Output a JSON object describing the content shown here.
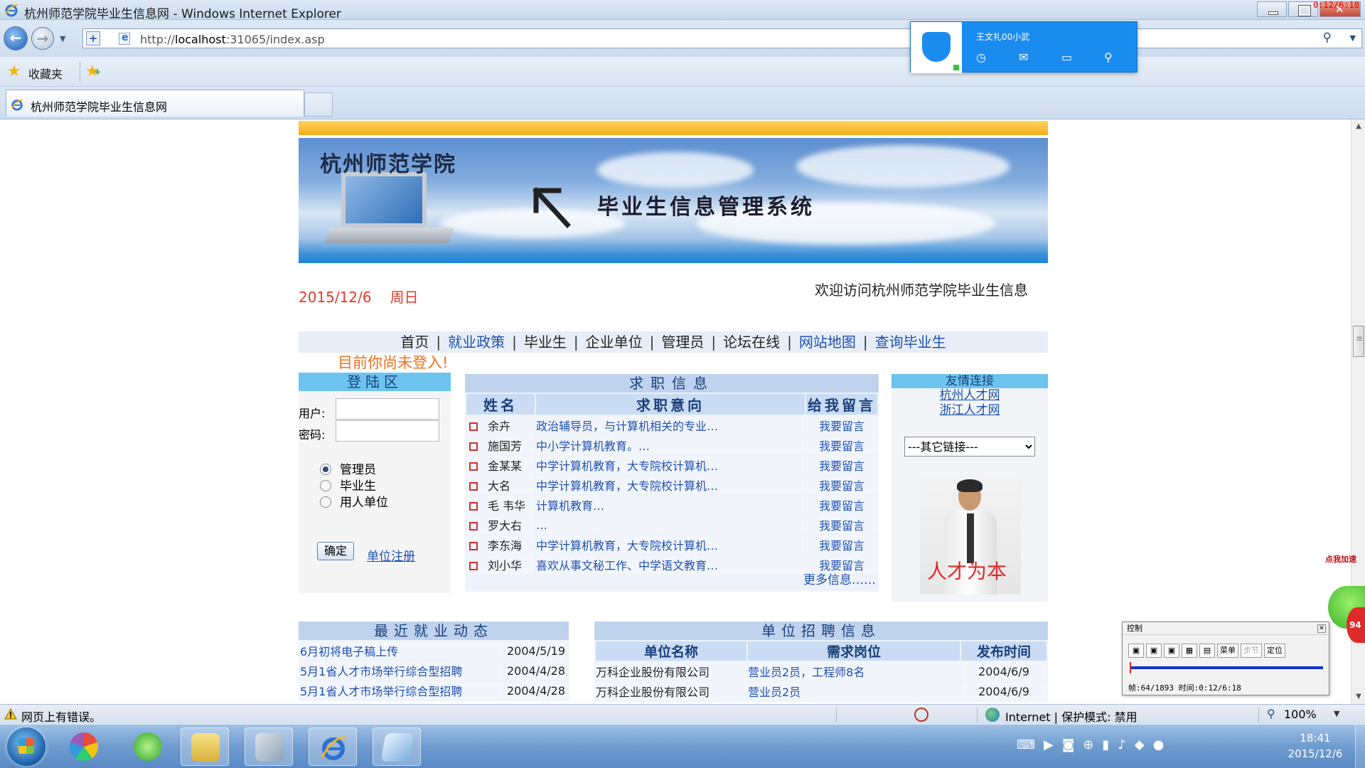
{
  "window": {
    "title": "杭州师范学院毕业生信息网 - Windows Internet Explorer",
    "rec_time": "0:12/6:18"
  },
  "address": {
    "url_prefix": "http://",
    "url_host": "localhost",
    "url_rest": ":31065/index.asp"
  },
  "favorites": {
    "label": "收藏夹"
  },
  "tab": {
    "title": "杭州师范学院毕业生信息网"
  },
  "qq_popup": {
    "name": "王文礼00小武"
  },
  "banner": {
    "school": "杭州师范学院",
    "system": "毕业生信息管理系统"
  },
  "page": {
    "date": "2015/12/6",
    "weekday": "周日",
    "marquee": "欢迎访问杭州师范学院毕业生信息",
    "not_logged_in": "目前你尚未登入!"
  },
  "menu": {
    "items": [
      {
        "label": "首页",
        "color": "#222222"
      },
      {
        "label": "就业政策",
        "color": "#1d4fb0"
      },
      {
        "label": "毕业生",
        "color": "#222222"
      },
      {
        "label": "企业单位",
        "color": "#222222"
      },
      {
        "label": "管理员",
        "color": "#222222"
      },
      {
        "label": "论坛在线",
        "color": "#222222"
      },
      {
        "label": "网站地图",
        "color": "#1d4fb0"
      },
      {
        "label": "查询毕业生",
        "color": "#1d4fb0"
      }
    ],
    "separator": "|"
  },
  "login": {
    "title": "登陆区",
    "user_label": "用户:",
    "password_label": "密码:",
    "roles": [
      "管理员",
      "毕业生",
      "用人单位"
    ],
    "selected_role": "管理员",
    "submit": "确定",
    "register_link": "单位注册"
  },
  "jobs": {
    "title": "求职信息",
    "headers": [
      "姓名",
      "求职意向",
      "给我留言"
    ],
    "rows": [
      {
        "name": "余卉",
        "intent": "政治辅导员，与计算机相关的专业…",
        "msg": "我要留言"
      },
      {
        "name": "施国芳",
        "intent": "中小学计算机教育。…",
        "msg": "我要留言"
      },
      {
        "name": "金某某",
        "intent": "中学计算机教育，大专院校计算机…",
        "msg": "我要留言"
      },
      {
        "name": "大名",
        "intent": "中学计算机教育，大专院校计算机…",
        "msg": "我要留言"
      },
      {
        "name": "毛 韦华",
        "intent": "计算机教育…",
        "msg": "我要留言"
      },
      {
        "name": "罗大右",
        "intent": "…",
        "msg": "我要留言"
      },
      {
        "name": "李东海",
        "intent": "中学计算机教育，大专院校计算机…",
        "msg": "我要留言"
      },
      {
        "name": "刘小华",
        "intent": "喜欢从事文秘工作、中学语文教育…",
        "msg": "我要留言"
      }
    ],
    "more": "更多信息……"
  },
  "friends": {
    "title": "友情连接",
    "links": [
      "杭州人才网",
      "浙江人才网"
    ],
    "select_value": "---其它链接---",
    "slogan": "人才为本"
  },
  "news": {
    "title": "最近就业动态",
    "rows": [
      {
        "title": "6月初将电子稿上传",
        "date": "2004/5/19"
      },
      {
        "title": "5月1省人才市场举行综合型招聘",
        "date": "2004/4/28"
      },
      {
        "title": "5月1省人才市场举行综合型招聘",
        "date": "2004/4/28"
      }
    ]
  },
  "recruit": {
    "title": "单位招聘信息",
    "headers": [
      "单位名称",
      "需求岗位",
      "发布时间"
    ],
    "rows": [
      {
        "company": "万科企业股份有限公司",
        "post": "营业员2员，工程师8名",
        "date": "2004/6/9"
      },
      {
        "company": "万科企业股份有限公司",
        "post": "营业员2员",
        "date": "2004/6/9"
      }
    ]
  },
  "record_control": {
    "title": "控制",
    "buttons": [
      "菜单",
      "步节",
      "定位"
    ],
    "info": "帧:64/1893 时间:0:12/6:18"
  },
  "speedup": {
    "label": "点我加速",
    "value": "94"
  },
  "statusbar": {
    "error": "网页上有错误。",
    "zone": "Internet | 保护模式: 禁用",
    "zoom": "100%"
  },
  "taskbar": {
    "time": "18:41",
    "date": "2015/12/6"
  }
}
